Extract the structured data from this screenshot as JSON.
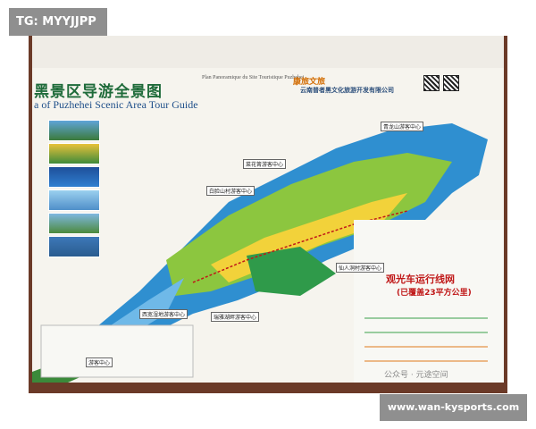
{
  "overlay": {
    "tag": "TG: MYYJJPP",
    "site": "www.wan-kysports.com"
  },
  "map": {
    "title_cn": "黑景区导游全景图",
    "title_en": "a of Puzhehei Scenic Area Tour Guide",
    "plan_note": "Plan Panoramique du Site Touristique Puzhehei",
    "brand": "康旅文旅",
    "company_cn": "云南普者黑文化旅游开发有限公司",
    "legend_title": "观光车运行线网",
    "legend_subtitle": "(已覆盖23平方公里)",
    "labels": [
      "青龙山游客中心",
      "菜花箐游客中心",
      "白脸山村游客中心",
      "仙人洞村游客中心",
      "西宽湿地游客中心",
      "瑞雅湖畔游客中心",
      "游客中心"
    ],
    "watermark": "公众号 · 元途空间"
  },
  "colors": {
    "frame": "#6b3a28",
    "lake": "#2f8fd0",
    "land": "#8cc63f",
    "title_red": "#c01818"
  }
}
